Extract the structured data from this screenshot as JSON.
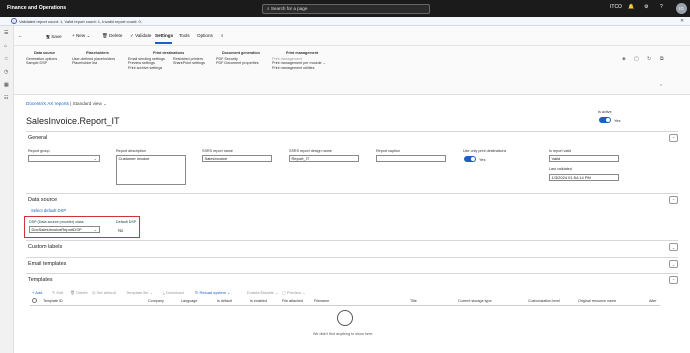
{
  "app": {
    "title": "Finance and Operations",
    "search_placeholder": "Search for a page",
    "company": "ITCO",
    "avatar": "IG"
  },
  "message": "Validated report count: 1, Valid report count: 1, Invalid report count: 0.",
  "actions": {
    "save": "Save",
    "new": "New",
    "delete": "Delete",
    "validate": "Validate",
    "settings": "Settings",
    "tools": "Tools",
    "options": "Options"
  },
  "ribbon": {
    "data_source": {
      "header": "Data source",
      "items": [
        "Generation options",
        "Sample DSP"
      ]
    },
    "placeholders": {
      "header": "Placeholders",
      "items": [
        "User-defined placeholders",
        "Placeholder list"
      ]
    },
    "print_destinations": {
      "header": "Print destinations",
      "col1": [
        "Email sending settings",
        "Preview settings",
        "Print archive settings"
      ],
      "col2": [
        "Restricted printers",
        "SharePoint settings"
      ]
    },
    "document_generation": {
      "header": "Document generation",
      "items": [
        "PDF Security",
        "PDF Document properties"
      ]
    },
    "print_management": {
      "header": "Print management",
      "items": [
        "Print management",
        "Print management per module",
        "Print management utilities"
      ]
    }
  },
  "breadcrumb": {
    "root": "DocentriX AX reports",
    "view": "Standard view"
  },
  "page_title": "SalesInvoice.Report_IT",
  "is_active": {
    "label": "Is active",
    "value": "Yes"
  },
  "general": {
    "header": "General",
    "report_group": {
      "label": "Report group",
      "value": ""
    },
    "report_description": {
      "label": "Report description",
      "value": "Customer invoice"
    },
    "ssrs_report_name": {
      "label": "SSRS report name",
      "value": "SalesInvoice"
    },
    "ssrs_report_design": {
      "label": "SSRS report design name",
      "value": "Report_IT"
    },
    "report_caption": {
      "label": "Report caption",
      "value": ""
    },
    "use_only_print": {
      "label": "Use only print destinations",
      "value": "Yes"
    },
    "is_report_valid": {
      "label": "Is report valid",
      "value": "Valid"
    },
    "last_validated": {
      "label": "Last validated",
      "value": "1/3/2024 01:54:14 PM"
    }
  },
  "data_source": {
    "header": "Data source",
    "select_link": "Select default DSP",
    "dsp_class": {
      "label": "DSP (Data source provider) class",
      "value": "DocSalesInvoiceReportDSP"
    },
    "default_dsp": {
      "label": "Default DSP",
      "value": "No"
    }
  },
  "custom_labels": "Custom labels",
  "email_templates": "Email templates",
  "templates": {
    "header": "Templates",
    "tools": {
      "add": "Add",
      "edit": "Edit",
      "delete": "Delete",
      "set_default": "Set default",
      "template_file": "Template file",
      "download": "Download",
      "reload": "Reload system",
      "enable_disable": "Enable/Disable",
      "preview": "Preview"
    },
    "columns": [
      "Template ID",
      "Company",
      "Language",
      "Is default",
      "Is enabled",
      "File attached",
      "Filename",
      "Title",
      "Current storage type",
      "Customization level",
      "Original resource name",
      "Alter"
    ],
    "empty": "We didn't find anything to show here."
  }
}
